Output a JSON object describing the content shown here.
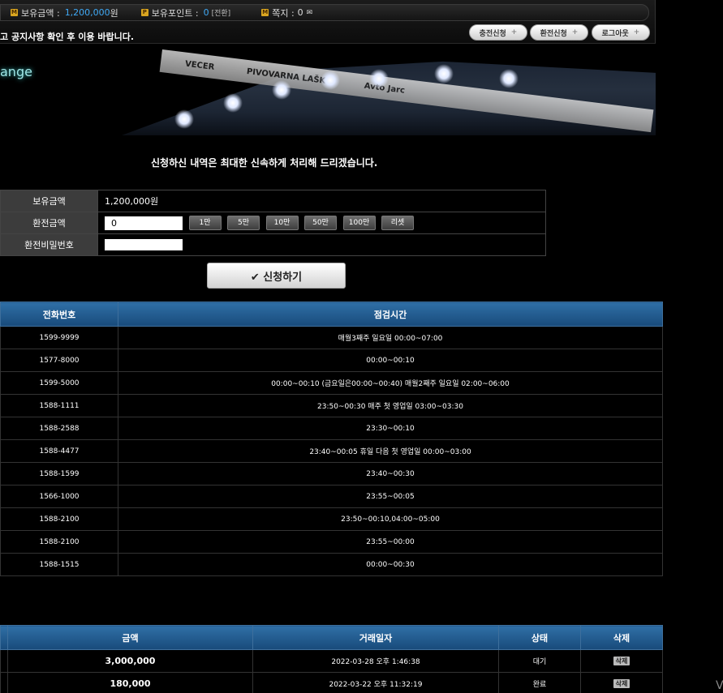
{
  "info_bar": {
    "balance_label": "보유금액 :",
    "balance_value": "1,200,000",
    "balance_unit": "원",
    "points_label": "보유포인트 :",
    "points_value": "0",
    "points_convert": "[전환]",
    "message_label": "쪽지 :",
    "message_value": "0",
    "message_icon": "envelope-icon"
  },
  "notice": "고 공지사항 확인 후 이용 바랍니다.",
  "top_buttons": {
    "charge": "충전신청",
    "exchange": "환전신청",
    "logout": "로그아웃",
    "plus": "+"
  },
  "banner": {
    "title": "ange",
    "ads": [
      "VECER",
      "PIVOVARNA LAŠKO",
      "Avto Jarc"
    ]
  },
  "subtitle": "신청하신 내역은 최대한 신속하게 처리해 드리겠습니다.",
  "form": {
    "balance_label": "보유금액",
    "balance_value": "1,200,000원",
    "amount_label": "환전금액",
    "amount_value": "0",
    "password_label": "환전비밀번호",
    "amount_buttons": [
      "1만",
      "5만",
      "10만",
      "50만",
      "100만",
      "리셋"
    ],
    "submit_label": "✔ 신청하기"
  },
  "maintenance_table": {
    "headers": [
      "전화번호",
      "점검시간"
    ],
    "rows": [
      [
        "1599-9999",
        "매월3째주 일요일 00:00~07:00"
      ],
      [
        "1577-8000",
        "00:00~00:10"
      ],
      [
        "1599-5000",
        "00:00~00:10 (금요일은00:00~00:40) 매월2째주 일요일 02:00~06:00"
      ],
      [
        "1588-1111",
        "23:50~00:30 매주 첫 영업일 03:00~03:30"
      ],
      [
        "1588-2588",
        "23:30~00:10"
      ],
      [
        "1588-4477",
        "23:40~00:05 휴일 다음 첫 영업일 00:00~03:00"
      ],
      [
        "1588-1599",
        "23:40~00:30"
      ],
      [
        "1566-1000",
        "23:55~00:05"
      ],
      [
        "1588-2100",
        "23:50~00:10,04:00~05:00"
      ],
      [
        "1588-2100",
        "23:55~00:00"
      ],
      [
        "1588-1515",
        "00:00~00:30"
      ]
    ]
  },
  "history_table": {
    "headers": [
      "",
      "금액",
      "거래일자",
      "상태",
      "삭제"
    ],
    "rows": [
      {
        "amount": "3,000,000",
        "date": "2022-03-28 오후 1:46:38",
        "status": "대기",
        "delete": "삭제"
      },
      {
        "amount": "180,000",
        "date": "2022-03-22 오후 11:32:19",
        "status": "완료",
        "delete": "삭제"
      }
    ]
  },
  "corner_text": "V"
}
